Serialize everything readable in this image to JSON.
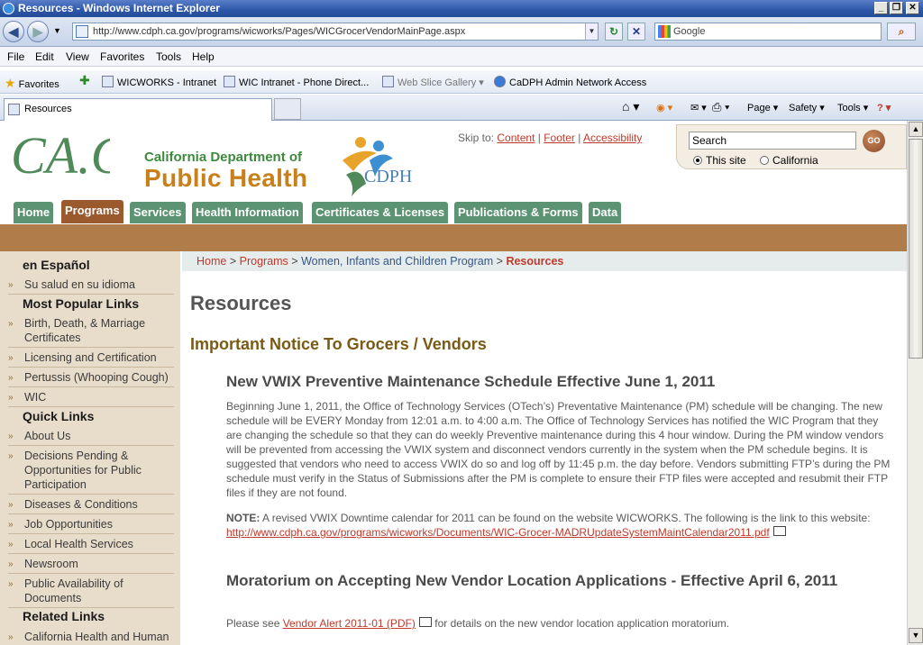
{
  "window": {
    "title": "Resources - Windows Internet Explorer",
    "minimize": "_",
    "restore": "❐",
    "close": "✕"
  },
  "addressbar": {
    "url": "http://www.cdph.ca.gov/programs/wicworks/Pages/WICGrocerVendorMainPage.aspx",
    "search_placeholder": "Google",
    "refresh": "↻",
    "stop": "✕",
    "search_go": "⌕"
  },
  "menubar": [
    "File",
    "Edit",
    "View",
    "Favorites",
    "Tools",
    "Help"
  ],
  "favorites": {
    "label": "Favorites",
    "items": [
      "WICWORKS - Intranet",
      "WIC Intranet - Phone Direct...",
      "Web Slice Gallery ▾",
      "CaDPH Admin Network Access"
    ]
  },
  "tabs": {
    "active": "Resources"
  },
  "commandbar": [
    "Page ▾",
    "Safety ▾",
    "Tools ▾"
  ],
  "site": {
    "cagov_logo": "CA.GOV",
    "dept_sub": "California Department of",
    "dept_main": "Public Health",
    "cdph_logo": "CDPH",
    "skip_to": "Skip to:",
    "skip_links": [
      "Content",
      "Footer",
      "Accessibility"
    ],
    "search_value": "Search",
    "go": "GO",
    "radio_this_site": "This site",
    "radio_california": "California",
    "nav": [
      "Home",
      "Programs",
      "Services",
      "Health Information",
      "Certificates & Licenses",
      "Publications & Forms",
      "Data"
    ],
    "nav_active": "Programs"
  },
  "sidebar": {
    "en_espanol": "en Español",
    "su_salud": "Su salud en su idioma",
    "most_popular": "Most Popular Links",
    "popular": [
      "Birth, Death, & Marriage Certificates",
      "Licensing and Certification",
      "Pertussis (Whooping Cough)",
      "WIC"
    ],
    "quick_links": "Quick Links",
    "quick": [
      "About Us",
      "Decisions Pending & Opportunities for Public Participation",
      "Diseases & Conditions",
      "Job Opportunities",
      "Local Health Services",
      "Newsroom",
      "Public Availability of Documents"
    ],
    "related_links": "Related Links",
    "related": [
      "California Health and Human"
    ]
  },
  "breadcrumb": {
    "home": "Home",
    "programs": "Programs",
    "wic": "Women, Infants and Children Program",
    "current": "Resources",
    "sep": ">"
  },
  "content": {
    "title": "Resources",
    "notice": "Important Notice To Grocers / Vendors",
    "s1_title": "New VWIX Preventive Maintenance Schedule Effective June 1, 2011",
    "s1_body": "Beginning June 1, 2011, the Office of Technology Services (OTech’s) Preventative Maintenance (PM) schedule will be changing. The new schedule will be EVERY Monday from 12:01 a.m. to 4:00 a.m.  The Office of Technology Services has notified the WIC Program that they are changing the schedule so that they can do weekly Preventive maintenance during this 4 hour window. During the PM window vendors will be prevented from accessing the VWIX system and disconnect vendors currently in the system when the PM schedule begins.  It is suggested that vendors who need to access VWIX do so and log off by 11:45 p.m. the day before.  Vendors submitting FTP’s during the PM schedule must verify in the Status of Submissions after the PM is complete to ensure their FTP files were accepted and resubmit their FTP files if they are not found.",
    "note_label": "NOTE:",
    "note_text": "A revised VWIX Downtime calendar for 2011 can be found on the website WICWORKS. The following is the link to this website:",
    "note_link": "http://www.cdph.ca.gov/programs/wicworks/Documents/WIC-Grocer-MADRUpdateSystemMaintCalendar2011.pdf",
    "s2_title": "Moratorium on Accepting New Vendor Location Applications - Effective April 6, 2011",
    "s2_pre": "Please see",
    "s2_link": "Vendor Alert 2011-01 (PDF)",
    "s2_post": "for details on the new vendor location application moratorium."
  }
}
